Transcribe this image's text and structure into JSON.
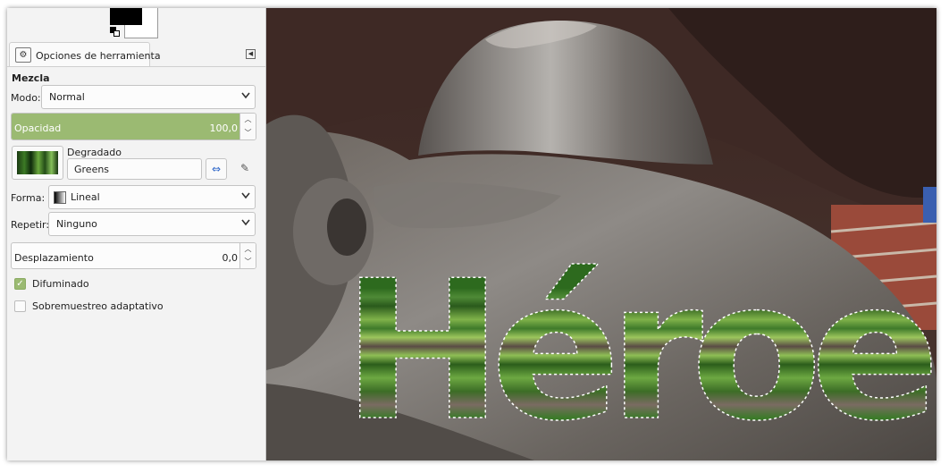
{
  "tool_options": {
    "tab_label": "Opciones de herramienta",
    "section_title": "Mezcla",
    "mode_label": "Modo:",
    "mode_value": "Normal",
    "opacity_label": "Opacidad",
    "opacity_value": "100,0",
    "opacity_fraction": 1.0,
    "gradient_label": "Degradado",
    "gradient_name": "Greens",
    "shape_label": "Forma:",
    "shape_value": "Lineal",
    "repeat_label": "Repetir:",
    "repeat_value": "Ninguno",
    "offset_label": "Desplazamiento",
    "offset_value": "0,0",
    "dithering_label": "Difuminado",
    "dithering_checked": true,
    "supersampling_label": "Sobremuestreo adaptativo",
    "supersampling_checked": false
  },
  "canvas": {
    "text": "Héroe",
    "text_color": "#2d6a1e"
  },
  "colors": {
    "accent": "#9bba72",
    "foreground": "#000000",
    "background": "#ffffff"
  }
}
